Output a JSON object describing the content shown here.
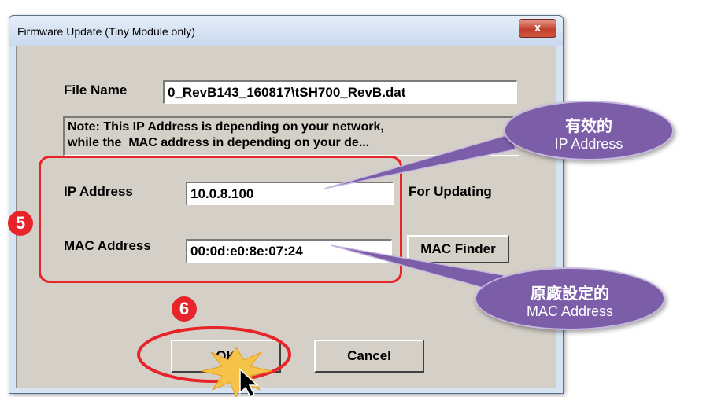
{
  "window": {
    "title": "Firmware Update (Tiny Module only)",
    "close_label": "x"
  },
  "form": {
    "file_name_label": "File Name",
    "file_name_value": "0_RevB143_160817\\tSH700_RevB.dat",
    "note_line1": "Note: This IP Address is depending on your network,",
    "note_line2": "while the  MAC address in depending on your de...",
    "ip_label": "IP Address",
    "ip_value": "10.0.8.100",
    "for_updating_label": "For Updating",
    "mac_label": "MAC Address",
    "mac_value": "00:0d:e0:8e:07:24",
    "mac_finder_label": "MAC Finder",
    "ok_label": "OK",
    "cancel_label": "Cancel"
  },
  "annotations": {
    "step5": "5",
    "step6": "6",
    "callout_ip_line1": "有效的",
    "callout_ip_line2": "IP Address",
    "callout_mac_line1": "原廠設定的",
    "callout_mac_line2": "MAC Address",
    "highlight_color": "#e8242b",
    "callout_color": "#7b5da8"
  }
}
